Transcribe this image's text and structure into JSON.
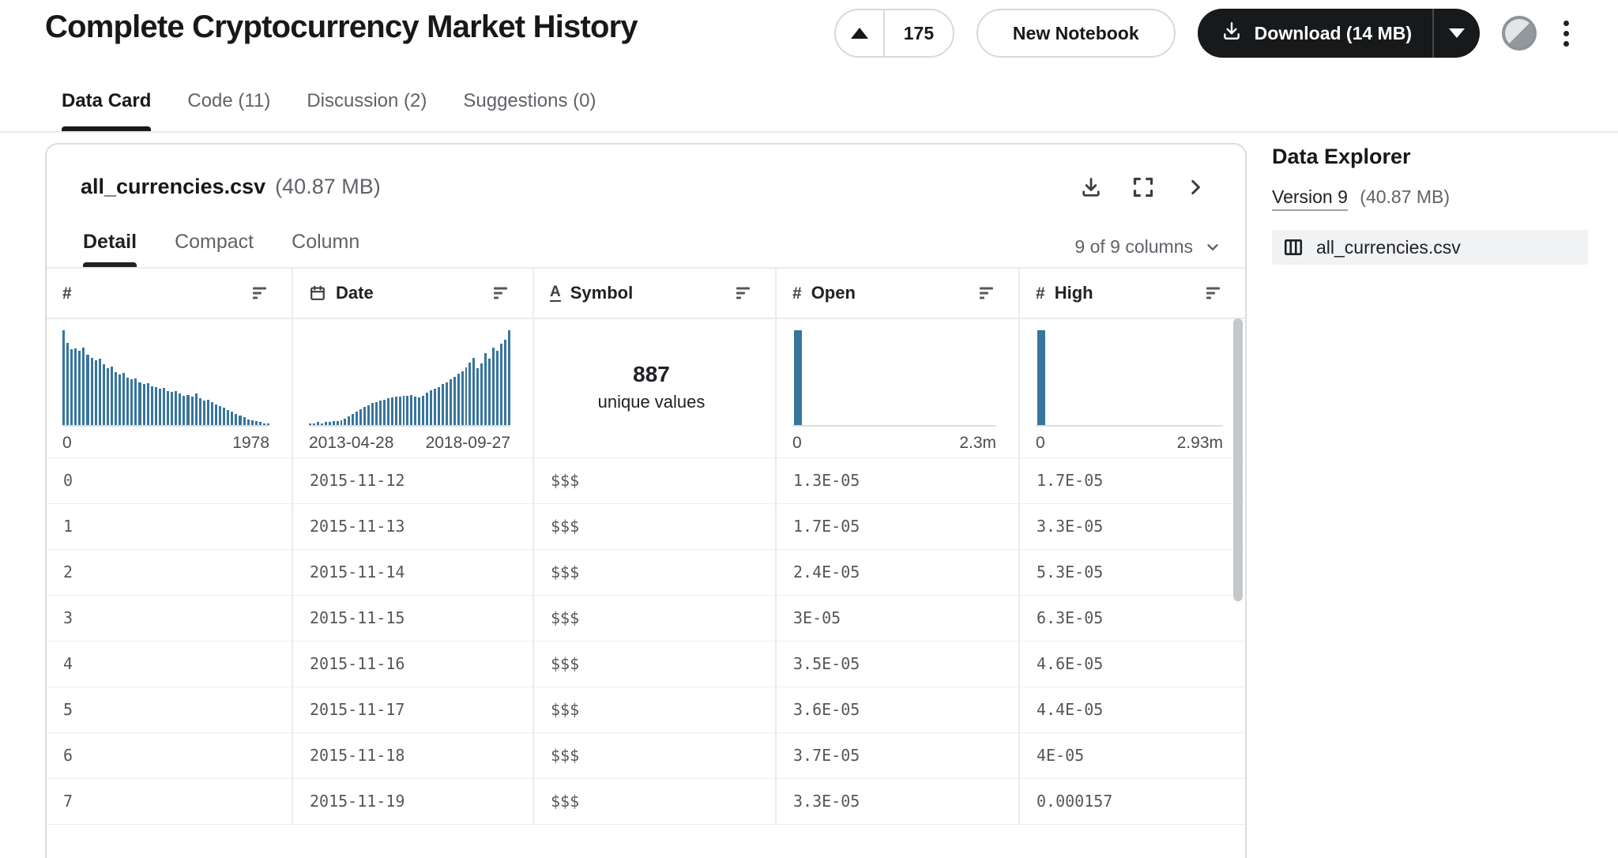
{
  "page": {
    "title": "Complete Cryptocurrency Market History"
  },
  "actions": {
    "upvote_count": "175",
    "new_notebook_label": "New Notebook",
    "download_label": "Download (14 MB)"
  },
  "nav_tabs": [
    {
      "label": "Data Card",
      "active": true
    },
    {
      "label": "Code (11)",
      "active": false
    },
    {
      "label": "Discussion (2)",
      "active": false
    },
    {
      "label": "Suggestions (0)",
      "active": false
    }
  ],
  "file_card": {
    "filename": "all_currencies.csv",
    "filesize": "(40.87 MB)",
    "view_tabs": [
      {
        "label": "Detail",
        "active": true
      },
      {
        "label": "Compact",
        "active": false
      },
      {
        "label": "Column",
        "active": false
      }
    ],
    "columns_selector": "9 of 9 columns"
  },
  "data_explorer": {
    "title": "Data Explorer",
    "version_link": "Version 9",
    "version_size": "(40.87 MB)",
    "file_name": "all_currencies.csv"
  },
  "table": {
    "headers": [
      {
        "label": "",
        "type": "numeric"
      },
      {
        "label": "Date",
        "type": "calendar"
      },
      {
        "label": "Symbol",
        "type": "text"
      },
      {
        "label": "Open",
        "type": "numeric"
      },
      {
        "label": "High",
        "type": "numeric"
      }
    ],
    "rows": [
      [
        "0",
        "2015-11-12",
        "$$$",
        "1.3E-05",
        "1.7E-05"
      ],
      [
        "1",
        "2015-11-13",
        "$$$",
        "1.7E-05",
        "3.3E-05"
      ],
      [
        "2",
        "2015-11-14",
        "$$$",
        "2.4E-05",
        "5.3E-05"
      ],
      [
        "3",
        "2015-11-15",
        "$$$",
        "3E-05",
        "6.3E-05"
      ],
      [
        "4",
        "2015-11-16",
        "$$$",
        "3.5E-05",
        "4.6E-05"
      ],
      [
        "5",
        "2015-11-17",
        "$$$",
        "3.6E-05",
        "4.4E-05"
      ],
      [
        "6",
        "2015-11-18",
        "$$$",
        "3.7E-05",
        "4E-05"
      ],
      [
        "7",
        "2015-11-19",
        "$$$",
        "3.3E-05",
        "0.000157"
      ]
    ]
  },
  "chart_data": [
    {
      "type": "bar",
      "column": "index",
      "xlabel_min": "0",
      "xlabel_max": "1978",
      "bar_color": "#38759d",
      "values": [
        1.0,
        0.87,
        0.8,
        0.81,
        0.78,
        0.82,
        0.74,
        0.71,
        0.68,
        0.7,
        0.64,
        0.6,
        0.62,
        0.56,
        0.53,
        0.55,
        0.5,
        0.48,
        0.49,
        0.45,
        0.43,
        0.44,
        0.41,
        0.4,
        0.38,
        0.39,
        0.36,
        0.35,
        0.36,
        0.33,
        0.31,
        0.32,
        0.3,
        0.33,
        0.28,
        0.26,
        0.27,
        0.24,
        0.22,
        0.2,
        0.18,
        0.16,
        0.14,
        0.12,
        0.1,
        0.08,
        0.06,
        0.05,
        0.04,
        0.03,
        0.02,
        0.02
      ]
    },
    {
      "type": "bar",
      "column": "Date",
      "xlabel_min": "2013-04-28",
      "xlabel_max": "2018-09-27",
      "bar_color": "#38759d",
      "values": [
        0.02,
        0.02,
        0.03,
        0.02,
        0.03,
        0.03,
        0.04,
        0.04,
        0.05,
        0.07,
        0.09,
        0.12,
        0.14,
        0.17,
        0.19,
        0.21,
        0.23,
        0.24,
        0.26,
        0.27,
        0.28,
        0.29,
        0.3,
        0.3,
        0.31,
        0.31,
        0.32,
        0.3,
        0.29,
        0.31,
        0.34,
        0.37,
        0.38,
        0.4,
        0.43,
        0.45,
        0.48,
        0.51,
        0.54,
        0.57,
        0.61,
        0.66,
        0.71,
        0.6,
        0.65,
        0.76,
        0.7,
        0.82,
        0.78,
        0.86,
        0.9,
        1.0
      ]
    },
    {
      "type": "summary",
      "column": "Symbol",
      "value": "887",
      "caption": "unique values"
    },
    {
      "type": "bar",
      "column": "Open",
      "xlabel_min": "0",
      "xlabel_max": "2.3m",
      "bar_color": "#38759d",
      "single_bar": true,
      "values": [
        1
      ]
    },
    {
      "type": "bar",
      "column": "High",
      "xlabel_min": "0",
      "xlabel_max": "2.93m",
      "bar_color": "#38759d",
      "single_bar": true,
      "values": [
        1
      ]
    }
  ],
  "colors": {
    "accent_bar": "#38759d",
    "download_button_bg": "#17191b",
    "selected_file_bg": "#f1f2f3"
  }
}
